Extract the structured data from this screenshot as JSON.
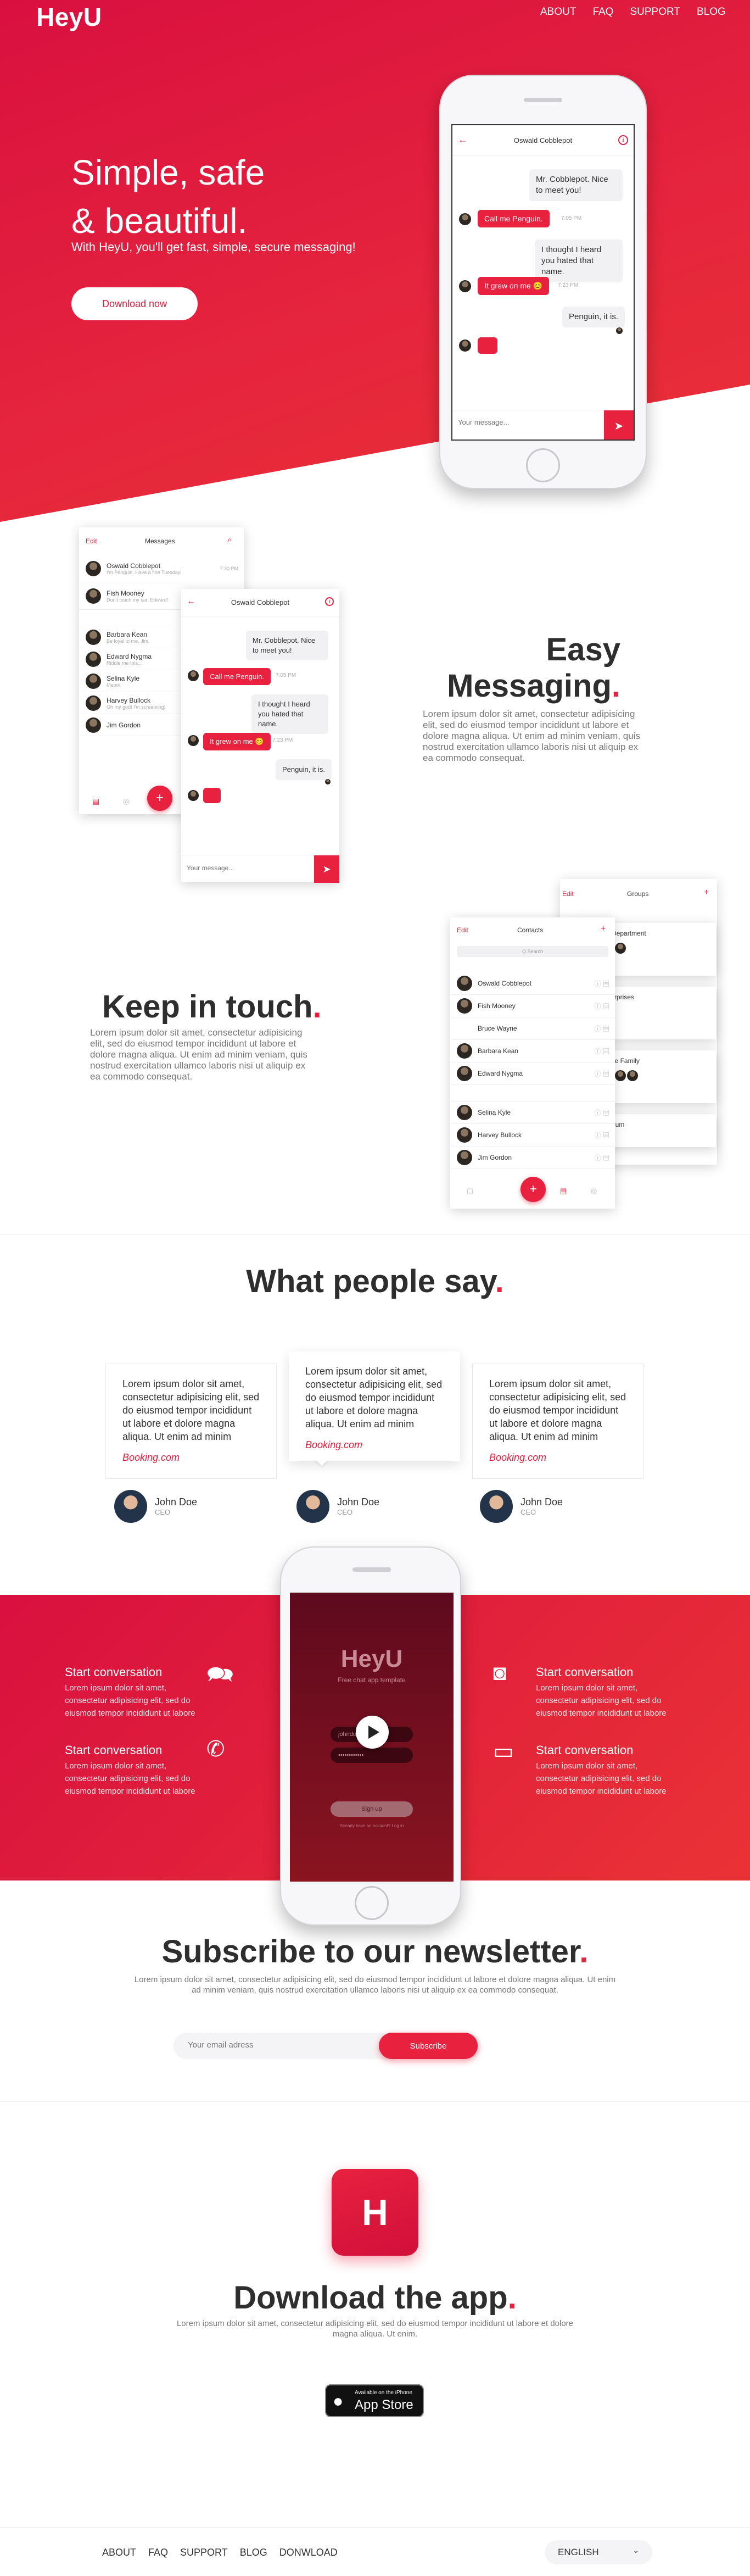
{
  "brand": {
    "name": "HeyU",
    "accent": "#e8213f"
  },
  "nav": {
    "items": [
      "ABOUT",
      "FAQ",
      "SUPPORT",
      "BLOG"
    ]
  },
  "hero": {
    "title_line1": "Simple, safe",
    "title_line2": "& beautiful.",
    "subtitle": "With HeyU, you'll get fast, simple, secure messaging!",
    "cta": "Download now"
  },
  "chat": {
    "contact": "Oswald Cobblepot",
    "messages": [
      {
        "dir": "in",
        "text": "Mr. Cobblepot. Nice to meet you!"
      },
      {
        "dir": "out",
        "text": "Call me Penguin.",
        "time": "7:05 PM"
      },
      {
        "dir": "in",
        "text": "I thought I heard you hated that name."
      },
      {
        "dir": "out",
        "text": "It grew on me 😊",
        "time": "7:23 PM"
      },
      {
        "dir": "in",
        "text": "Penguin, it is."
      }
    ],
    "input_placeholder": "Your message...",
    "send_icon": "send-icon",
    "back_icon": "back-arrow-icon",
    "info_icon": "info-icon"
  },
  "easy": {
    "title_line1": "Easy",
    "title_line2": "Messaging",
    "text": "Lorem ipsum dolor sit amet, consectetur adipisicing elit, sed do eiusmod tempor incididunt ut labore et dolore magna aliqua. Ut enim ad minim veniam, quis nostrud exercitation ullamco laboris nisi ut aliquip ex ea commodo consequat."
  },
  "messages_list": {
    "edit": "Edit",
    "title": "Messages",
    "items": [
      {
        "name": "Oswald Cobblepot",
        "preview": "I'm Penguin. Have a fine Tuesday!",
        "time": "7:30 PM"
      },
      {
        "name": "Fish Mooney",
        "preview": "Don't touch my car, Edward!"
      },
      {
        "name": "Barbara Kean",
        "preview": "Be loyal to me, Jim."
      },
      {
        "name": "Edward Nygma",
        "preview": "Riddle me this..."
      },
      {
        "name": "Selina Kyle",
        "preview": "Meow."
      },
      {
        "name": "Harvey Bullock",
        "preview": "Oh my god! I'm screaming!"
      },
      {
        "name": "Jim Gordon",
        "preview": ""
      }
    ]
  },
  "keep": {
    "title": "Keep in touch",
    "text": "Lorem ipsum dolor sit amet, consectetur adipisicing elit, sed do eiusmod tempor incididunt ut labore et dolore magna aliqua. Ut enim ad minim veniam, quis nostrud exercitation ullamco laboris nisi ut aliquip ex ea commodo consequat."
  },
  "contacts": {
    "edit": "Edit",
    "title": "Contacts",
    "search_placeholder": "Q Search",
    "items": [
      "Oswald Cobblepot",
      "Fish Mooney",
      "Bruce Wayne",
      "Barbara Kean",
      "Edward Nygma",
      "Selina Kyle",
      "Harvey Bullock",
      "Jim Gordon"
    ]
  },
  "groups": {
    "edit": "Edit",
    "title": "Groups",
    "items": [
      "City Police Department",
      "Wayne Enterprises",
      "Wayne Crime Family",
      "Arkham Asylum"
    ]
  },
  "testimonials": {
    "title": "What people say",
    "items": [
      {
        "text": "Lorem ipsum dolor sit amet, consectetur adipisicing elit, sed do eiusmod tempor incididunt ut labore et dolore magna aliqua. Ut enim ad minim",
        "source": "Booking.com",
        "name": "John Doe",
        "role": "CEO"
      },
      {
        "text": "Lorem ipsum dolor sit amet, consectetur adipisicing elit, sed do eiusmod tempor incididunt ut labore et dolore magna aliqua. Ut enim ad minim",
        "source": "Booking.com",
        "name": "John Doe",
        "role": "CEO"
      },
      {
        "text": "Lorem ipsum dolor sit amet, consectetur adipisicing elit, sed do eiusmod tempor incididunt ut labore et dolore magna aliqua. Ut enim ad minim",
        "source": "Booking.com",
        "name": "John Doe",
        "role": "CEO"
      }
    ]
  },
  "features": {
    "items": [
      {
        "title": "Start conversation",
        "text": "Lorem ipsum dolor sit amet, consectetur adipisicing elit, sed do eiusmod tempor incididunt ut labore",
        "icon": "chat-bubbles-icon"
      },
      {
        "title": "Start conversation",
        "text": "Lorem ipsum dolor sit amet, consectetur adipisicing elit, sed do eiusmod tempor incididunt ut labore",
        "icon": "phone-call-icon"
      },
      {
        "title": "Start conversation",
        "text": "Lorem ipsum dolor sit amet, consectetur adipisicing elit, sed do eiusmod tempor incididunt ut labore",
        "icon": "camera-icon"
      },
      {
        "title": "Start conversation",
        "text": "Lorem ipsum dolor sit amet, consectetur adipisicing elit, sed do eiusmod tempor incididunt ut labore",
        "icon": "video-camera-icon"
      }
    ]
  },
  "app_video": {
    "logo": "HeyU",
    "tagline": "Free chat app template",
    "username": "johndoe",
    "password": "••••••••••••",
    "signup": "Sign up",
    "login_hint": "Already have an account? Log in"
  },
  "newsletter": {
    "title": "Subscribe to our newsletter",
    "text": "Lorem ipsum dolor sit amet, consectetur adipisicing elit, sed do eiusmod tempor incididunt ut labore et dolore magna aliqua. Ut enim ad minim veniam, quis nostrud exercitation ullamco laboris nisi ut aliquip ex ea commodo consequat.",
    "placeholder": "Your email adress",
    "button": "Subscribe"
  },
  "download": {
    "icon_letter": "H",
    "title": "Download the app",
    "text": "Lorem ipsum dolor sit amet, consectetur adipisicing elit, sed do eiusmod tempor incididunt ut labore et dolore magna aliqua. Ut enim.",
    "store_small": "Available on the iPhone",
    "store_big": "App Store"
  },
  "footer": {
    "links": [
      "ABOUT",
      "FAQ",
      "SUPPORT",
      "BLOG",
      "DONWLOAD"
    ],
    "language": "ENGLISH"
  }
}
